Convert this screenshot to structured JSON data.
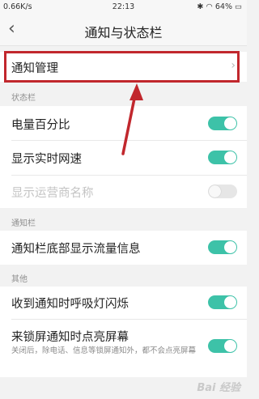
{
  "status_bar": {
    "left": "0.66K/s",
    "time": "22:13",
    "battery": "64%"
  },
  "nav": {
    "back_glyph": "‹",
    "title": "通知与状态栏"
  },
  "rows": {
    "notify_manage": "通知管理",
    "section_status": "状态栏",
    "battery_percent": "电量百分比",
    "net_speed": "显示实时网速",
    "carrier_name": "显示运营商名称",
    "section_notify": "通知栏",
    "traffic_info": "通知栏底部显示流量信息",
    "section_other": "其他",
    "breath_light": "收到通知时呼吸灯闪烁",
    "wake_screen": "来锁屏通知时点亮屏幕",
    "wake_screen_desc": "关闭后，除电话、信息等锁屏通知外，都不会点亮屏幕"
  },
  "toggles": {
    "battery_percent": true,
    "net_speed": true,
    "carrier_name": false,
    "traffic_info": true,
    "breath_light": true,
    "wake_screen": true
  },
  "colors": {
    "accent": "#3dc2a8",
    "highlight": "#c1272d"
  },
  "icons": [
    "back-icon",
    "chevron-right-icon",
    "wifi-icon",
    "bluetooth-icon",
    "battery-icon"
  ],
  "watermark": "Bai 经验"
}
